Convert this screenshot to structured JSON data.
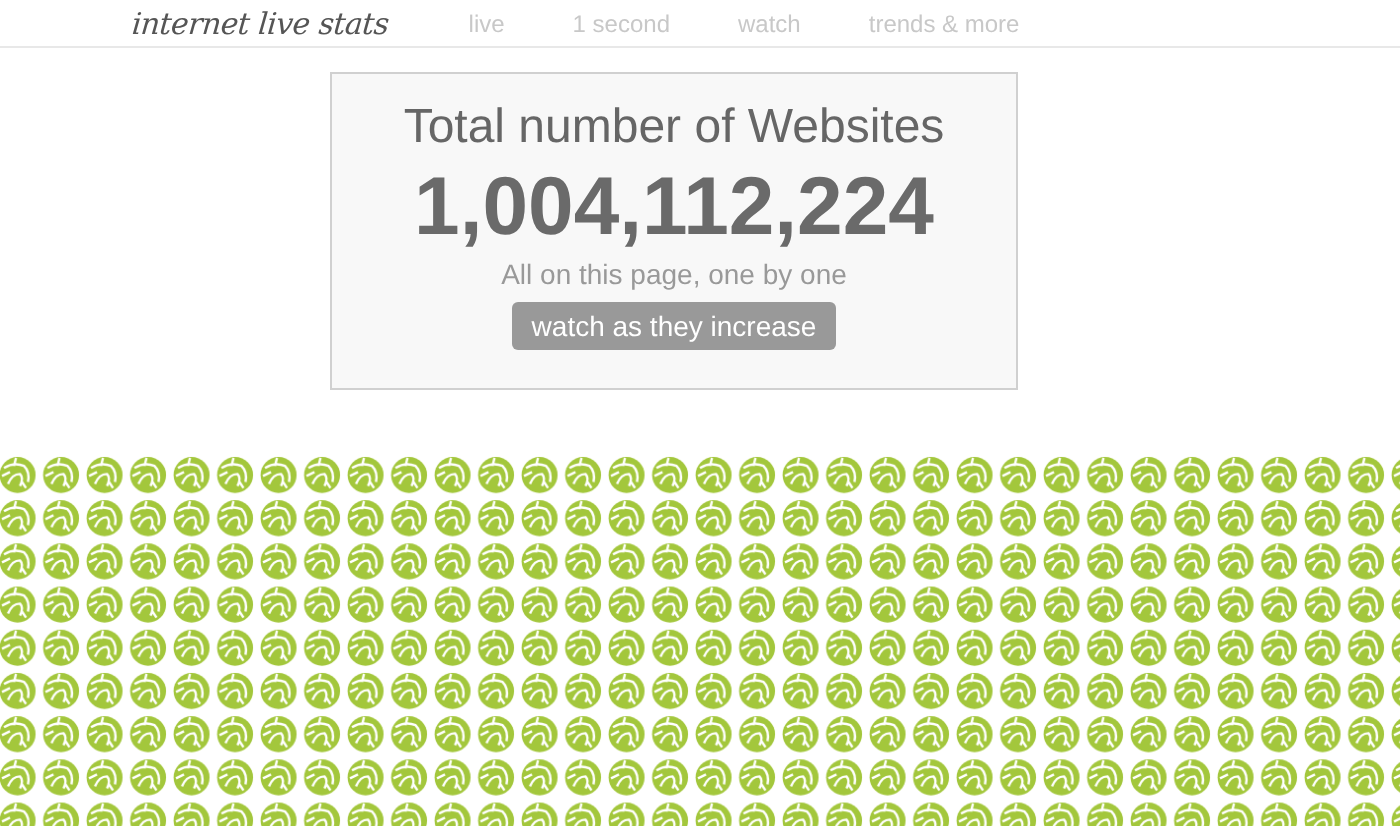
{
  "header": {
    "logo": "internet live stats",
    "nav": [
      {
        "label": "live"
      },
      {
        "label": "1 second"
      },
      {
        "label": "watch"
      },
      {
        "label": "trends & more"
      }
    ]
  },
  "card": {
    "title": "Total number of Websites",
    "count": "1,004,112,224",
    "subtitle": "All on this page, one by one",
    "button": "watch as they increase"
  }
}
